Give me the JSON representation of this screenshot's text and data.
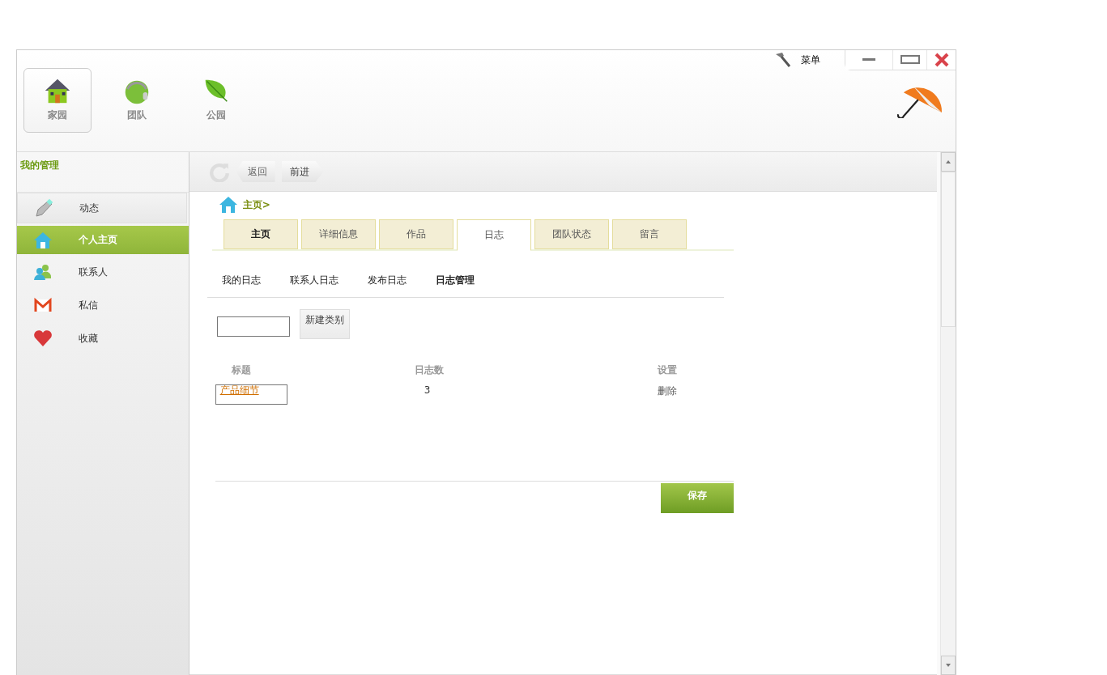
{
  "titlebar": {
    "menu_label": "菜单"
  },
  "top_nav": [
    {
      "label": "家园",
      "selected": true,
      "kind": "house"
    },
    {
      "label": "团队",
      "selected": false,
      "kind": "globe"
    },
    {
      "label": "公园",
      "selected": false,
      "kind": "leaf"
    }
  ],
  "sidebar": {
    "title": "我的管理",
    "items": [
      {
        "label": "动态",
        "selected": false,
        "kind": "pen"
      },
      {
        "label": "个人主页",
        "selected": true,
        "kind": "home"
      },
      {
        "label": "联系人",
        "selected": false,
        "kind": "people"
      },
      {
        "label": "私信",
        "selected": false,
        "kind": "mail"
      },
      {
        "label": "收藏",
        "selected": false,
        "kind": "heart"
      }
    ]
  },
  "toolbar": {
    "back": "返回",
    "forward": "前进"
  },
  "breadcrumb": "主页>",
  "tabs": [
    {
      "label": "主页",
      "selected": false,
      "bold": true
    },
    {
      "label": "详细信息",
      "selected": false,
      "bold": false
    },
    {
      "label": "作品",
      "selected": false,
      "bold": false
    },
    {
      "label": "日志",
      "selected": true,
      "bold": false
    },
    {
      "label": "团队状态",
      "selected": false,
      "bold": false
    },
    {
      "label": "留言",
      "selected": false,
      "bold": false
    }
  ],
  "subtabs": [
    {
      "label": "我的日志",
      "selected": false
    },
    {
      "label": "联系人日志",
      "selected": false
    },
    {
      "label": "发布日志",
      "selected": false
    },
    {
      "label": "日志管理",
      "selected": true
    }
  ],
  "new_category_button": "新建类别",
  "table": {
    "columns": [
      "标题",
      "日志数",
      "设置"
    ],
    "rows": [
      {
        "title": "产品细节",
        "count": "3",
        "action": "删除"
      }
    ]
  },
  "save_button": "保存"
}
